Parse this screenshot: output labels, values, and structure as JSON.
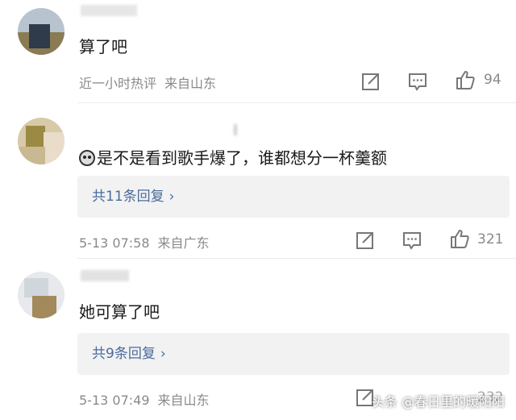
{
  "comments": [
    {
      "text": "算了吧",
      "meta_time": "近一小时热评",
      "meta_location": "来自山东",
      "likes": "94"
    },
    {
      "text": "是不是看到歌手爆了，谁都想分一杯羹额",
      "reply_label": "共11条回复",
      "meta_time": "5-13 07:58",
      "meta_location": "来自广东",
      "likes": "321"
    },
    {
      "text": "她可算了吧",
      "reply_label": "共9条回复",
      "meta_time": "5-13 07:49",
      "meta_location": "来自山东",
      "likes": "232"
    }
  ],
  "chevron": "›",
  "watermark": "头条 @春日里的暖阳阳"
}
